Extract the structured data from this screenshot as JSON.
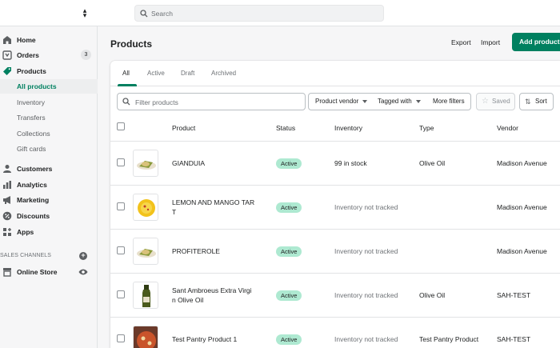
{
  "topbar": {
    "search_placeholder": "Search"
  },
  "sidebar": {
    "items": [
      {
        "label": "Home",
        "icon": "home-icon"
      },
      {
        "label": "Orders",
        "icon": "orders-icon",
        "badge": "3"
      },
      {
        "label": "Products",
        "icon": "tag-icon"
      },
      {
        "label": "All products"
      },
      {
        "label": "Inventory"
      },
      {
        "label": "Transfers"
      },
      {
        "label": "Collections"
      },
      {
        "label": "Gift cards"
      },
      {
        "label": "Customers",
        "icon": "person-icon"
      },
      {
        "label": "Analytics",
        "icon": "bar-chart-icon"
      },
      {
        "label": "Marketing",
        "icon": "megaphone-icon"
      },
      {
        "label": "Discounts",
        "icon": "discount-icon"
      },
      {
        "label": "Apps",
        "icon": "apps-icon"
      },
      {
        "label": "Online Store",
        "icon": "store-icon"
      }
    ],
    "sales_channels_label": "SALES CHANNELS"
  },
  "header": {
    "title": "Products",
    "export_label": "Export",
    "import_label": "Import",
    "add_label": "Add product"
  },
  "tabs": [
    "All",
    "Active",
    "Draft",
    "Archived"
  ],
  "filters": {
    "placeholder": "Filter products",
    "vendor_label": "Product vendor",
    "tagged_label": "Tagged with",
    "more_label": "More filters",
    "saved_label": "Saved",
    "sort_label": "Sort"
  },
  "table": {
    "columns": [
      "Product",
      "Status",
      "Inventory",
      "Type",
      "Vendor"
    ],
    "rows": [
      {
        "product": "GIANDUIA",
        "status": "Active",
        "inventory": "99 in stock",
        "type": "Olive Oil",
        "vendor": "Madison Avenue"
      },
      {
        "product": "LEMON AND MANGO TAR\nT",
        "status": "Active",
        "inventory": "Inventory not tracked",
        "type": "",
        "vendor": "Madison Avenue"
      },
      {
        "product": "PROFITEROLE",
        "status": "Active",
        "inventory": "Inventory not tracked",
        "type": "",
        "vendor": "Madison Avenue"
      },
      {
        "product": "Sant Ambroeus Extra Virgi\nn Olive Oil",
        "status": "Active",
        "inventory": "Inventory not tracked",
        "type": "Olive Oil",
        "vendor": "SAH-TEST"
      },
      {
        "product": "Test Pantry Product 1",
        "status": "Active",
        "inventory": "Inventory not tracked",
        "type": "Test Pantry Product",
        "vendor": "SAH-TEST"
      }
    ]
  },
  "colors": {
    "accent": "#008060",
    "status_active_bg": "#aee9d1"
  }
}
